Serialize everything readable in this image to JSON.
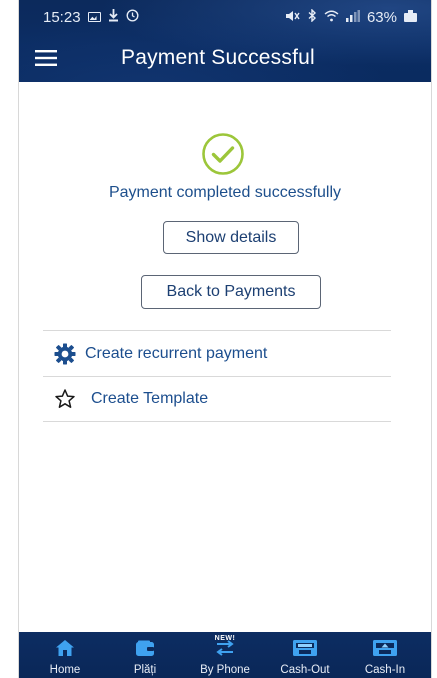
{
  "status_bar": {
    "time": "15:23",
    "battery_text": "63%"
  },
  "app_bar": {
    "title": "Payment Successful"
  },
  "result": {
    "message": "Payment completed successfully",
    "show_details_label": "Show details",
    "back_label": "Back to Payments"
  },
  "actions": [
    {
      "label": "Create recurrent payment",
      "icon": "gear-icon"
    },
    {
      "label": "Create Template",
      "icon": "star-outline-icon"
    }
  ],
  "bottom_nav": {
    "items": [
      {
        "label": "Home",
        "icon": "home-icon"
      },
      {
        "label": "Plăți",
        "icon": "wallet-icon"
      },
      {
        "label": "By Phone",
        "icon": "transfer-arrows-icon",
        "badge": "NEW!"
      },
      {
        "label": "Cash-Out",
        "icon": "atm-cash-out-icon"
      },
      {
        "label": "Cash-In",
        "icon": "atm-cash-in-icon"
      }
    ]
  },
  "colors": {
    "brand_navy": "#0b2c62",
    "success_green": "#9cc63a",
    "link_blue": "#1c4e8e",
    "nav_icon_blue": "#3fa2f0"
  }
}
